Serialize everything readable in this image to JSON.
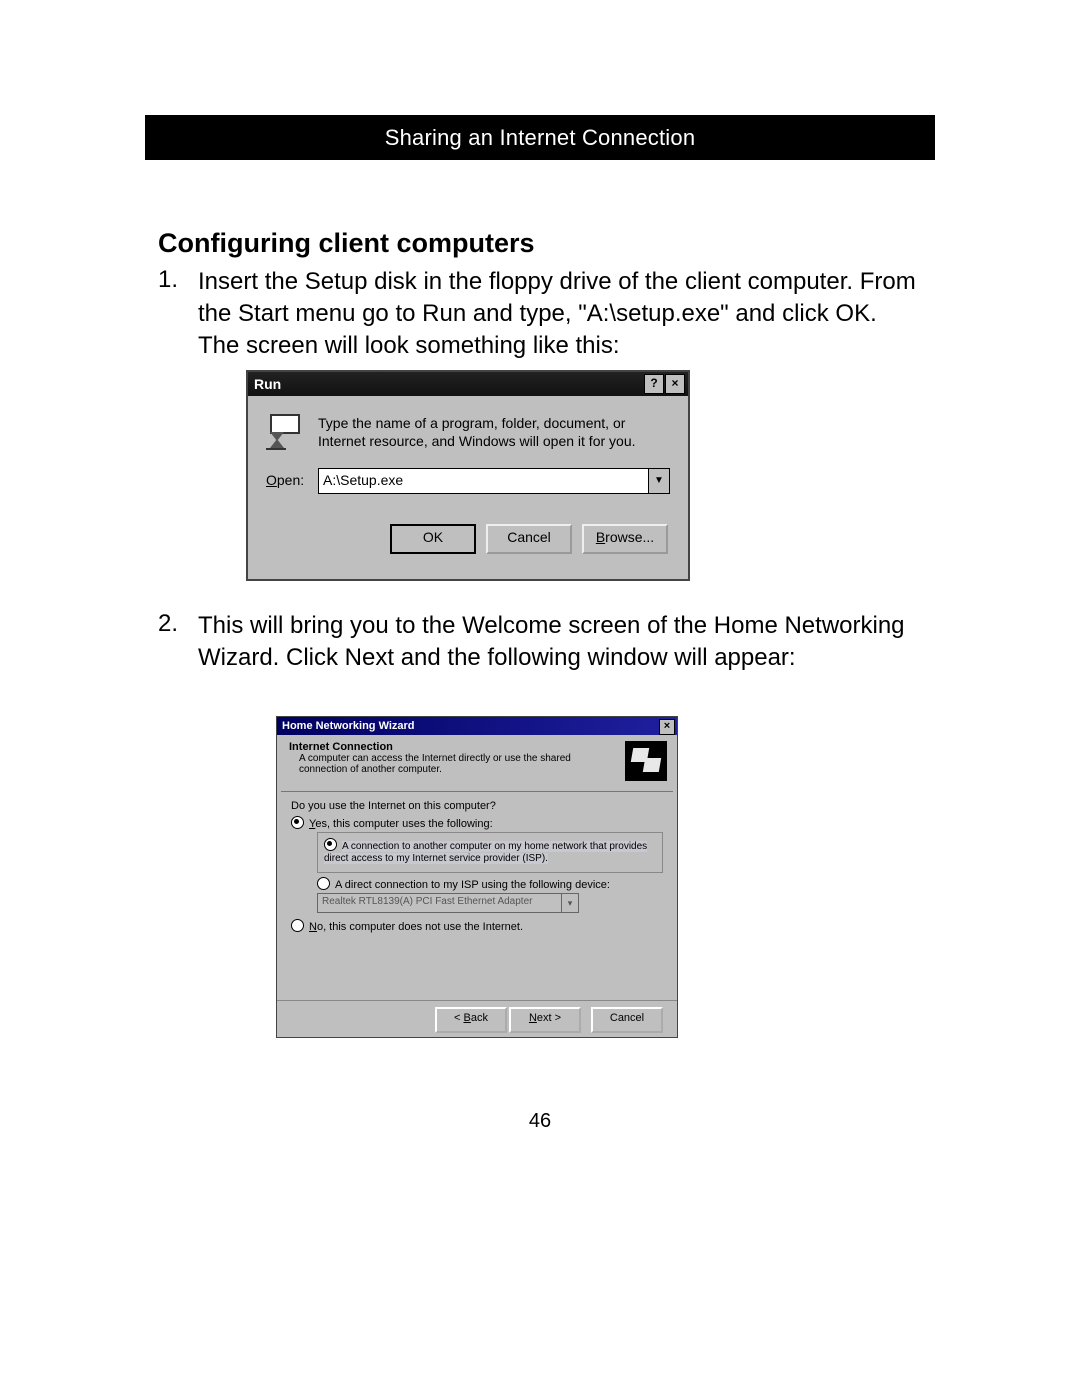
{
  "banner": "Sharing an Internet Connection",
  "section_title": "Configuring client computers",
  "step1_num": "1.",
  "step1_text": "Insert the Setup disk in the floppy drive of the client computer. From the Start menu go to Run and type, \"A:\\setup.exe\" and click OK. The screen will look something like this:",
  "step2_num": "2.",
  "step2_text": "This will bring you to the Welcome screen of the Home Networking Wizard. Click Next and the following window will appear:",
  "page_number": "46",
  "run": {
    "title": "Run",
    "help_btn": "?",
    "close_btn": "×",
    "message": "Type the name of a program, folder, document, or Internet resource, and Windows will open it for you.",
    "open_label_u": "O",
    "open_label_rest": "pen:",
    "input_value": "A:\\Setup.exe",
    "dropdown_arrow": "▼",
    "ok": "OK",
    "cancel": "Cancel",
    "browse_u": "B",
    "browse_rest": "rowse..."
  },
  "wizard": {
    "title": "Home Networking Wizard",
    "close_btn": "×",
    "header_title": "Internet Connection",
    "header_sub": "A computer can access the Internet directly or use the shared connection of another computer.",
    "question": "Do you use the Internet on this computer?",
    "yes_u": "Y",
    "yes_rest": "es, this computer uses the following:",
    "sub_a": "A connection to another computer on my home network that provides direct access to my Internet service provider (ISP).",
    "sub_b": "A direct connection to my ISP using the following device:",
    "device_name": "Realtek RTL8139(A) PCI Fast Ethernet Adapter",
    "device_arrow": "▾",
    "no_u": "N",
    "no_rest": "o, this computer does not use the Internet.",
    "back_lt": "< ",
    "back_u": "B",
    "back_rest": "ack",
    "next_u": "N",
    "next_rest": "ext >",
    "cancel": "Cancel"
  }
}
